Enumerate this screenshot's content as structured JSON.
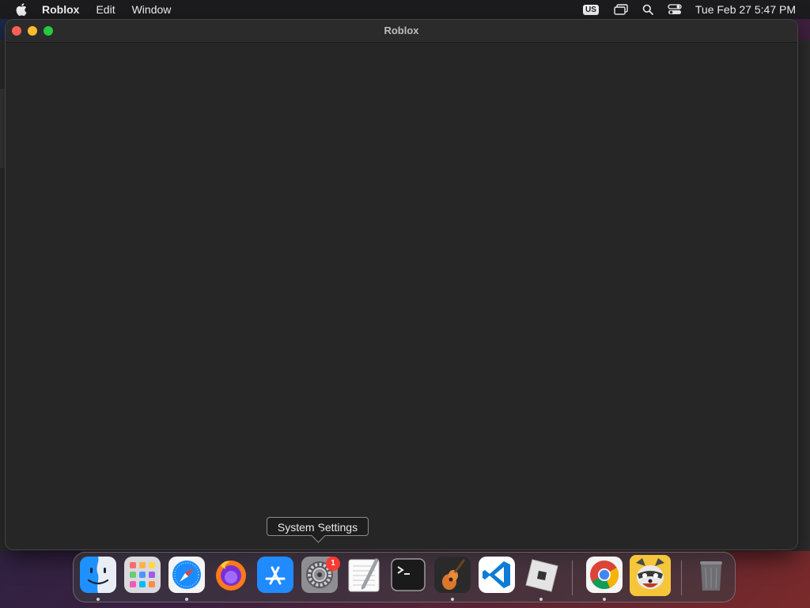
{
  "menubar": {
    "app_name": "Roblox",
    "items": [
      "Edit",
      "Window"
    ],
    "input_source": "US",
    "clock": "Tue Feb 27  5:47 PM"
  },
  "window": {
    "title": "Roblox"
  },
  "tooltip": {
    "text": "System Settings"
  },
  "dock": {
    "apps": [
      {
        "name": "Finder",
        "icon": "finder-icon",
        "running": true
      },
      {
        "name": "Launchpad",
        "icon": "launchpad-icon",
        "running": false
      },
      {
        "name": "Safari",
        "icon": "safari-icon",
        "running": true
      },
      {
        "name": "Firefox",
        "icon": "firefox-icon",
        "running": false
      },
      {
        "name": "App Store",
        "icon": "app-store-icon",
        "running": false
      },
      {
        "name": "System Settings",
        "icon": "system-settings-icon",
        "running": false,
        "badge": "1"
      },
      {
        "name": "TextEdit",
        "icon": "textedit-icon",
        "running": false
      },
      {
        "name": "Terminal",
        "icon": "terminal-icon",
        "running": false
      },
      {
        "name": "GarageBand",
        "icon": "garageband-icon",
        "running": true
      },
      {
        "name": "Visual Studio Code",
        "icon": "vscode-icon",
        "running": false
      },
      {
        "name": "Roblox",
        "icon": "roblox-icon",
        "running": true
      },
      {
        "name": "Google Chrome",
        "icon": "chrome-icon",
        "running": true
      },
      {
        "name": "Raccoon App",
        "icon": "raccoon-icon",
        "running": false
      },
      {
        "name": "Trash",
        "icon": "trash-icon",
        "running": false
      }
    ]
  },
  "colors": {
    "menubar_bg": "#1c1c1e",
    "window_bg": "#262626",
    "close": "#ff5f57",
    "minimize": "#febc2e",
    "maximize": "#28c840",
    "badge": "#ff3b30"
  }
}
